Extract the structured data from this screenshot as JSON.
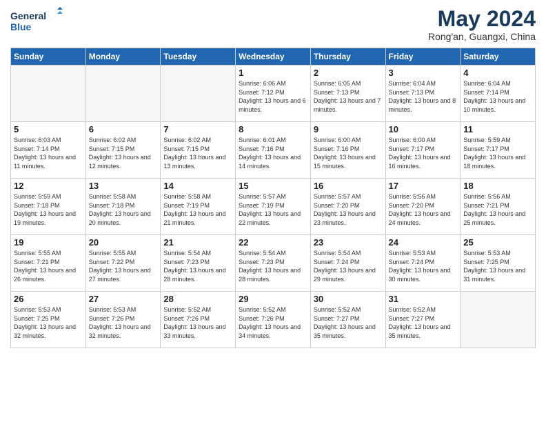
{
  "header": {
    "logo_line1": "General",
    "logo_line2": "Blue",
    "month_year": "May 2024",
    "location": "Rong'an, Guangxi, China"
  },
  "weekdays": [
    "Sunday",
    "Monday",
    "Tuesday",
    "Wednesday",
    "Thursday",
    "Friday",
    "Saturday"
  ],
  "weeks": [
    [
      {
        "day": "",
        "sunrise": "",
        "sunset": "",
        "daylight": "",
        "empty": true
      },
      {
        "day": "",
        "sunrise": "",
        "sunset": "",
        "daylight": "",
        "empty": true
      },
      {
        "day": "",
        "sunrise": "",
        "sunset": "",
        "daylight": "",
        "empty": true
      },
      {
        "day": "1",
        "sunrise": "Sunrise: 6:06 AM",
        "sunset": "Sunset: 7:12 PM",
        "daylight": "Daylight: 13 hours and 6 minutes.",
        "empty": false
      },
      {
        "day": "2",
        "sunrise": "Sunrise: 6:05 AM",
        "sunset": "Sunset: 7:13 PM",
        "daylight": "Daylight: 13 hours and 7 minutes.",
        "empty": false
      },
      {
        "day": "3",
        "sunrise": "Sunrise: 6:04 AM",
        "sunset": "Sunset: 7:13 PM",
        "daylight": "Daylight: 13 hours and 8 minutes.",
        "empty": false
      },
      {
        "day": "4",
        "sunrise": "Sunrise: 6:04 AM",
        "sunset": "Sunset: 7:14 PM",
        "daylight": "Daylight: 13 hours and 10 minutes.",
        "empty": false
      }
    ],
    [
      {
        "day": "5",
        "sunrise": "Sunrise: 6:03 AM",
        "sunset": "Sunset: 7:14 PM",
        "daylight": "Daylight: 13 hours and 11 minutes.",
        "empty": false
      },
      {
        "day": "6",
        "sunrise": "Sunrise: 6:02 AM",
        "sunset": "Sunset: 7:15 PM",
        "daylight": "Daylight: 13 hours and 12 minutes.",
        "empty": false
      },
      {
        "day": "7",
        "sunrise": "Sunrise: 6:02 AM",
        "sunset": "Sunset: 7:15 PM",
        "daylight": "Daylight: 13 hours and 13 minutes.",
        "empty": false
      },
      {
        "day": "8",
        "sunrise": "Sunrise: 6:01 AM",
        "sunset": "Sunset: 7:16 PM",
        "daylight": "Daylight: 13 hours and 14 minutes.",
        "empty": false
      },
      {
        "day": "9",
        "sunrise": "Sunrise: 6:00 AM",
        "sunset": "Sunset: 7:16 PM",
        "daylight": "Daylight: 13 hours and 15 minutes.",
        "empty": false
      },
      {
        "day": "10",
        "sunrise": "Sunrise: 6:00 AM",
        "sunset": "Sunset: 7:17 PM",
        "daylight": "Daylight: 13 hours and 16 minutes.",
        "empty": false
      },
      {
        "day": "11",
        "sunrise": "Sunrise: 5:59 AM",
        "sunset": "Sunset: 7:17 PM",
        "daylight": "Daylight: 13 hours and 18 minutes.",
        "empty": false
      }
    ],
    [
      {
        "day": "12",
        "sunrise": "Sunrise: 5:59 AM",
        "sunset": "Sunset: 7:18 PM",
        "daylight": "Daylight: 13 hours and 19 minutes.",
        "empty": false
      },
      {
        "day": "13",
        "sunrise": "Sunrise: 5:58 AM",
        "sunset": "Sunset: 7:18 PM",
        "daylight": "Daylight: 13 hours and 20 minutes.",
        "empty": false
      },
      {
        "day": "14",
        "sunrise": "Sunrise: 5:58 AM",
        "sunset": "Sunset: 7:19 PM",
        "daylight": "Daylight: 13 hours and 21 minutes.",
        "empty": false
      },
      {
        "day": "15",
        "sunrise": "Sunrise: 5:57 AM",
        "sunset": "Sunset: 7:19 PM",
        "daylight": "Daylight: 13 hours and 22 minutes.",
        "empty": false
      },
      {
        "day": "16",
        "sunrise": "Sunrise: 5:57 AM",
        "sunset": "Sunset: 7:20 PM",
        "daylight": "Daylight: 13 hours and 23 minutes.",
        "empty": false
      },
      {
        "day": "17",
        "sunrise": "Sunrise: 5:56 AM",
        "sunset": "Sunset: 7:20 PM",
        "daylight": "Daylight: 13 hours and 24 minutes.",
        "empty": false
      },
      {
        "day": "18",
        "sunrise": "Sunrise: 5:56 AM",
        "sunset": "Sunset: 7:21 PM",
        "daylight": "Daylight: 13 hours and 25 minutes.",
        "empty": false
      }
    ],
    [
      {
        "day": "19",
        "sunrise": "Sunrise: 5:55 AM",
        "sunset": "Sunset: 7:21 PM",
        "daylight": "Daylight: 13 hours and 26 minutes.",
        "empty": false
      },
      {
        "day": "20",
        "sunrise": "Sunrise: 5:55 AM",
        "sunset": "Sunset: 7:22 PM",
        "daylight": "Daylight: 13 hours and 27 minutes.",
        "empty": false
      },
      {
        "day": "21",
        "sunrise": "Sunrise: 5:54 AM",
        "sunset": "Sunset: 7:23 PM",
        "daylight": "Daylight: 13 hours and 28 minutes.",
        "empty": false
      },
      {
        "day": "22",
        "sunrise": "Sunrise: 5:54 AM",
        "sunset": "Sunset: 7:23 PM",
        "daylight": "Daylight: 13 hours and 28 minutes.",
        "empty": false
      },
      {
        "day": "23",
        "sunrise": "Sunrise: 5:54 AM",
        "sunset": "Sunset: 7:24 PM",
        "daylight": "Daylight: 13 hours and 29 minutes.",
        "empty": false
      },
      {
        "day": "24",
        "sunrise": "Sunrise: 5:53 AM",
        "sunset": "Sunset: 7:24 PM",
        "daylight": "Daylight: 13 hours and 30 minutes.",
        "empty": false
      },
      {
        "day": "25",
        "sunrise": "Sunrise: 5:53 AM",
        "sunset": "Sunset: 7:25 PM",
        "daylight": "Daylight: 13 hours and 31 minutes.",
        "empty": false
      }
    ],
    [
      {
        "day": "26",
        "sunrise": "Sunrise: 5:53 AM",
        "sunset": "Sunset: 7:25 PM",
        "daylight": "Daylight: 13 hours and 32 minutes.",
        "empty": false
      },
      {
        "day": "27",
        "sunrise": "Sunrise: 5:53 AM",
        "sunset": "Sunset: 7:26 PM",
        "daylight": "Daylight: 13 hours and 32 minutes.",
        "empty": false
      },
      {
        "day": "28",
        "sunrise": "Sunrise: 5:52 AM",
        "sunset": "Sunset: 7:26 PM",
        "daylight": "Daylight: 13 hours and 33 minutes.",
        "empty": false
      },
      {
        "day": "29",
        "sunrise": "Sunrise: 5:52 AM",
        "sunset": "Sunset: 7:26 PM",
        "daylight": "Daylight: 13 hours and 34 minutes.",
        "empty": false
      },
      {
        "day": "30",
        "sunrise": "Sunrise: 5:52 AM",
        "sunset": "Sunset: 7:27 PM",
        "daylight": "Daylight: 13 hours and 35 minutes.",
        "empty": false
      },
      {
        "day": "31",
        "sunrise": "Sunrise: 5:52 AM",
        "sunset": "Sunset: 7:27 PM",
        "daylight": "Daylight: 13 hours and 35 minutes.",
        "empty": false
      },
      {
        "day": "",
        "sunrise": "",
        "sunset": "",
        "daylight": "",
        "empty": true
      }
    ]
  ]
}
